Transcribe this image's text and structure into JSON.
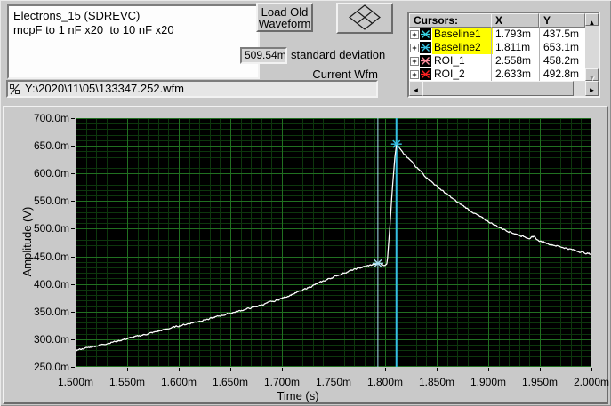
{
  "window": {
    "bg_color": "#c9c9c9"
  },
  "header": {
    "comment_lines": [
      "Electrons_15 (SDREVC)",
      "mcpF to 1 nF x20  to 10 nF x20"
    ],
    "load_button_lines": [
      "Load Old",
      "Waveform"
    ],
    "std_dev_value": "509.54m",
    "std_dev_label": "standard deviation",
    "current_wfm_label": "Current Wfm",
    "file_path": "Y:\\2020\\11\\05\\133347.252.wfm"
  },
  "cursors_panel": {
    "title": "Cursors:",
    "col_x": "X",
    "col_y": "Y",
    "expand_icon": "+",
    "scrollbar": {
      "up_icon": "▲",
      "down_icon": "▼",
      "left_icon": "◄",
      "right_icon": "►"
    },
    "rows": [
      {
        "name": "Baseline1",
        "x": "1.793m",
        "y": "437.5m",
        "highlighted": true,
        "glyph_color": "#38d6e6"
      },
      {
        "name": "Baseline2",
        "x": "1.811m",
        "y": "653.1m",
        "highlighted": true,
        "glyph_color": "#38c2e2"
      },
      {
        "name": "ROI_1",
        "x": "2.558m",
        "y": "458.2m",
        "highlighted": false,
        "glyph_color": "#ff8fa0"
      },
      {
        "name": "ROI_2",
        "x": "2.633m",
        "y": "492.8m",
        "highlighted": false,
        "glyph_color": "#ff2222"
      }
    ]
  },
  "chart_data": {
    "type": "line",
    "title": "",
    "xlabel": "Time (s)",
    "ylabel": "Amplitude (V)",
    "xlim": [
      1.5,
      2.0
    ],
    "ylim": [
      250,
      700
    ],
    "x_tick_labels": [
      "1.500m",
      "1.550m",
      "1.600m",
      "1.650m",
      "1.700m",
      "1.750m",
      "1.800m",
      "1.850m",
      "1.900m",
      "1.950m",
      "2.000m"
    ],
    "y_tick_labels": [
      "700.0m",
      "650.0m",
      "600.0m",
      "550.0m",
      "500.0m",
      "450.0m",
      "400.0m",
      "350.0m",
      "300.0m",
      "250.0m"
    ],
    "x_major_step": 0.05,
    "x_minor_step": 0.01,
    "y_major_step": 50,
    "y_minor_step": 10,
    "grid": true,
    "legend_position": "none",
    "plot_bg_color": "#000000",
    "grid_major_color": "#217021",
    "grid_minor_color": "#0d370d",
    "trace_color": "#ffffff",
    "series": [
      {
        "name": "Current Wfm",
        "keypoints": [
          [
            1.5,
            280
          ],
          [
            1.525,
            290
          ],
          [
            1.55,
            301
          ],
          [
            1.575,
            312
          ],
          [
            1.6,
            324
          ],
          [
            1.625,
            335
          ],
          [
            1.65,
            347
          ],
          [
            1.675,
            359
          ],
          [
            1.7,
            374
          ],
          [
            1.715,
            385
          ],
          [
            1.73,
            397
          ],
          [
            1.745,
            409
          ],
          [
            1.76,
            420
          ],
          [
            1.775,
            429
          ],
          [
            1.788,
            435
          ],
          [
            1.795,
            437
          ],
          [
            1.799,
            433
          ],
          [
            1.802,
            437
          ],
          [
            1.8045,
            500
          ],
          [
            1.807,
            572
          ],
          [
            1.8095,
            630
          ],
          [
            1.811,
            653
          ],
          [
            1.8125,
            650
          ],
          [
            1.815,
            644
          ],
          [
            1.82,
            632
          ],
          [
            1.83,
            612
          ],
          [
            1.84,
            593
          ],
          [
            1.85,
            577
          ],
          [
            1.86,
            562
          ],
          [
            1.87,
            548
          ],
          [
            1.88,
            536
          ],
          [
            1.89,
            524
          ],
          [
            1.9,
            513
          ],
          [
            1.91,
            503
          ],
          [
            1.92,
            495
          ],
          [
            1.93,
            488
          ],
          [
            1.94,
            483
          ],
          [
            1.944,
            486
          ],
          [
            1.948,
            479
          ],
          [
            1.96,
            472
          ],
          [
            1.975,
            465
          ],
          [
            1.99,
            458
          ],
          [
            2.0,
            454
          ]
        ]
      }
    ],
    "cursors": [
      {
        "name": "Baseline1",
        "x": 1.793,
        "y": 437.5,
        "color": "#a8dff0",
        "line_width": 1
      },
      {
        "name": "Baseline2",
        "x": 1.811,
        "y": 653.1,
        "color": "#36bfe4",
        "line_width": 2
      }
    ]
  }
}
